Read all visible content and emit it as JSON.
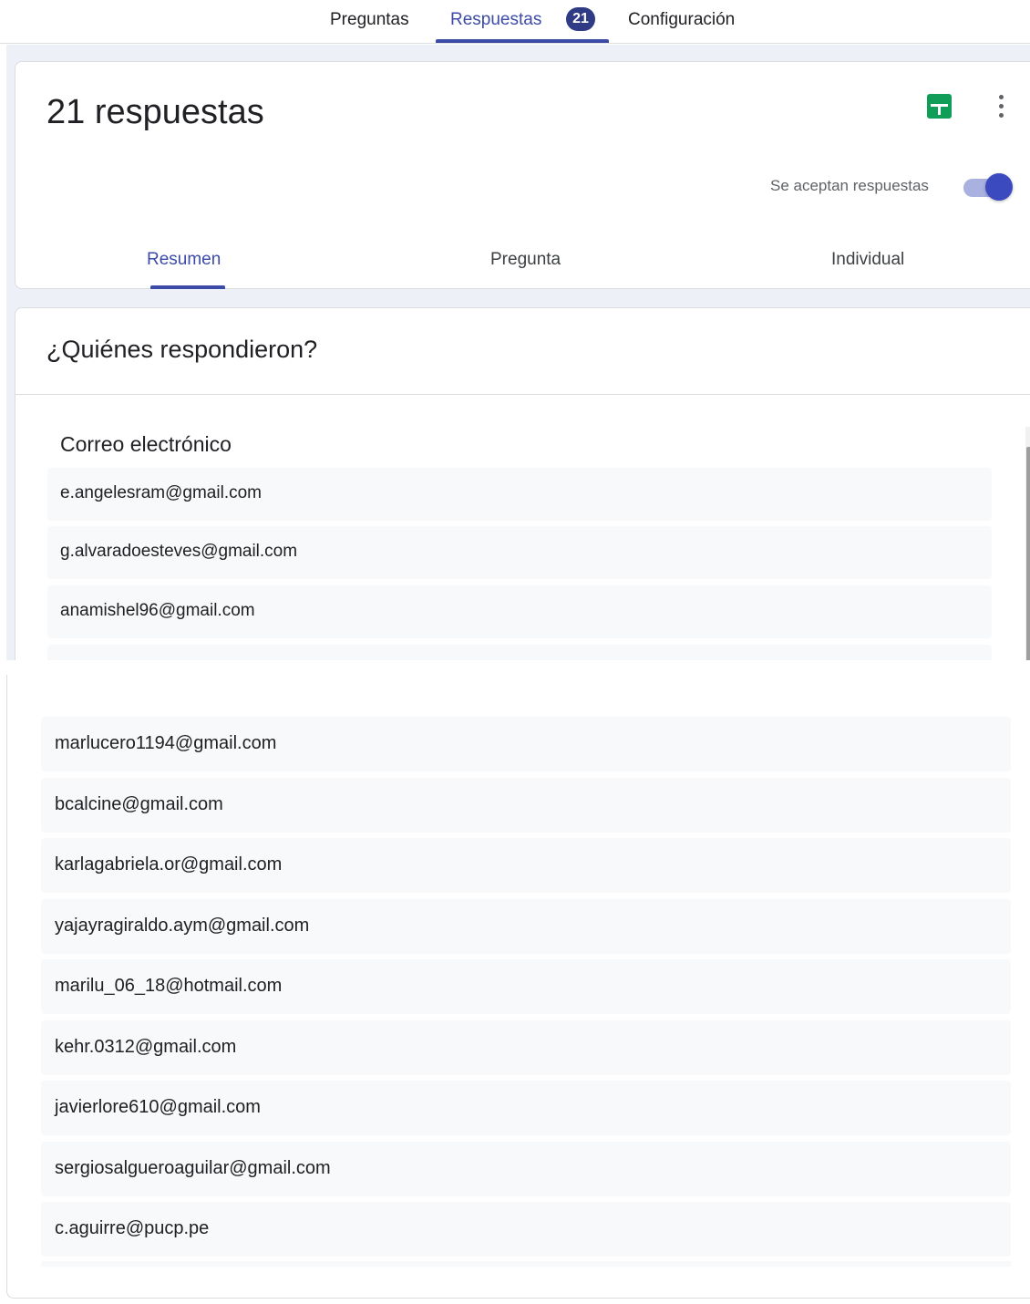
{
  "topnav": {
    "tabs": [
      {
        "label": "Preguntas"
      },
      {
        "label": "Respuestas"
      },
      {
        "label": "Configuración"
      }
    ],
    "active_tab": "Respuestas",
    "badge_count": "21"
  },
  "summary": {
    "title": "21 respuestas",
    "accepting_label": "Se aceptan respuestas",
    "accepting": true,
    "icons": [
      "sheets-icon",
      "more-vert-icon"
    ],
    "subtabs": [
      {
        "label": "Resumen"
      },
      {
        "label": "Pregunta"
      },
      {
        "label": "Individual"
      }
    ],
    "active_subtab": "Resumen"
  },
  "who": {
    "title": "¿Quiénes respondieron?",
    "column_header": "Correo electrónico",
    "emails_top": [
      "e.angelesram@gmail.com",
      "g.alvaradoesteves@gmail.com",
      "anamishel96@gmail.com"
    ],
    "emails_bottom": [
      "marlucero1194@gmail.com",
      "bcalcine@gmail.com",
      "karlagabriela.or@gmail.com",
      "yajayragiraldo.aym@gmail.com",
      "marilu_06_18@hotmail.com",
      "kehr.0312@gmail.com",
      "javierlore610@gmail.com",
      "sergiosalgueroaguilar@gmail.com",
      "c.aguirre@pucp.pe"
    ]
  },
  "colors": {
    "accent": "#3c4aa8",
    "badge": "#2f3b84",
    "sheets_green": "#0f9d58",
    "page_bg": "#eef0f8",
    "row_bg": "#f8f9fa"
  }
}
